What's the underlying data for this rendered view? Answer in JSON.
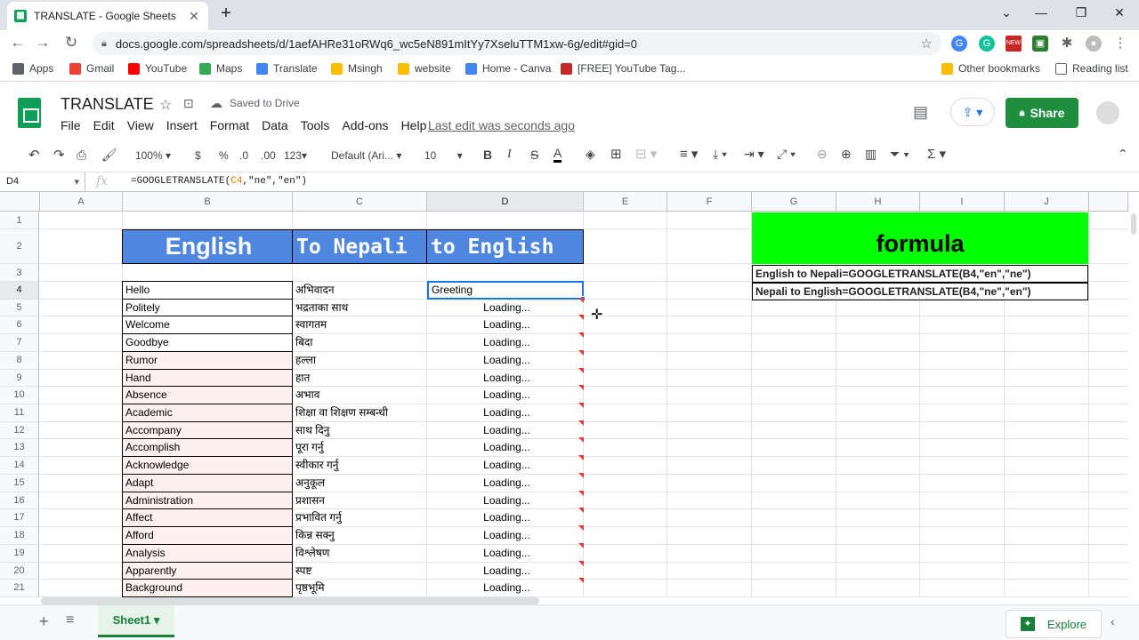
{
  "browser": {
    "tab_title": "TRANSLATE - Google Sheets",
    "url": "docs.google.com/spreadsheets/d/1aefAHRe31oRWq6_wc5eN891mItYy7XseluTTM1xw-6g/edit#gid=0",
    "bookmarks": [
      {
        "label": "Apps",
        "color": "#5f6368"
      },
      {
        "label": "Gmail",
        "color": "#ea4335"
      },
      {
        "label": "YouTube",
        "color": "#ff0000"
      },
      {
        "label": "Maps",
        "color": "#34a853"
      },
      {
        "label": "Translate",
        "color": "#4285f4"
      },
      {
        "label": "Msingh",
        "color": "#fbbc04"
      },
      {
        "label": "website",
        "color": "#fbbc04"
      },
      {
        "label": "Home - Canva",
        "color": "#4285f4"
      },
      {
        "label": "[FREE] YouTube Tag...",
        "color": "#c62828"
      }
    ],
    "other_bookmarks": "Other bookmarks",
    "reading_list": "Reading list",
    "ext_new": "NEW"
  },
  "app": {
    "title": "TRANSLATE",
    "saved": "Saved to Drive",
    "menus": [
      "File",
      "Edit",
      "View",
      "Insert",
      "Format",
      "Data",
      "Tools",
      "Add-ons",
      "Help"
    ],
    "last_edit": "Last edit was seconds ago",
    "share": "Share"
  },
  "toolbar": {
    "zoom": "100%",
    "currency": "$",
    "percent": "%",
    "dec_less": ".0",
    "dec_more": ".00",
    "format": "123",
    "font": "Default (Ari...",
    "size": "10"
  },
  "formula_bar": {
    "name_box": "D4",
    "fx": "fx",
    "formula_pre": "=GOOGLETRANSLATE(",
    "formula_ref": "C4",
    "formula_post": ",\"ne\",\"en\")"
  },
  "columns": [
    "A",
    "B",
    "C",
    "D",
    "E",
    "F",
    "G",
    "H",
    "I",
    "J"
  ],
  "rows": [
    "1",
    "2",
    "3",
    "4",
    "5",
    "6",
    "7",
    "8",
    "9",
    "10",
    "11",
    "12",
    "13",
    "14",
    "15",
    "16",
    "17",
    "18",
    "19",
    "20",
    "21"
  ],
  "headers": {
    "english": "English",
    "to_nepali": "To Nepali",
    "to_english": "to English"
  },
  "table": [
    {
      "en": "Hello",
      "ne": "अभिवादन",
      "out": "Greeting"
    },
    {
      "en": "Politely",
      "ne": "भद्रताका साथ",
      "out": "Loading..."
    },
    {
      "en": "Welcome",
      "ne": "स्वागतम",
      "out": "Loading..."
    },
    {
      "en": "Goodbye",
      "ne": "बिदा",
      "out": "Loading..."
    },
    {
      "en": "Rumor",
      "ne": "हल्ला",
      "out": "Loading..."
    },
    {
      "en": "Hand",
      "ne": "हात",
      "out": "Loading..."
    },
    {
      "en": "Absence",
      "ne": "अभाव",
      "out": "Loading..."
    },
    {
      "en": "Academic",
      "ne": "शिक्षा वा शिक्षण सम्बन्धी",
      "out": "Loading..."
    },
    {
      "en": "Accompany",
      "ne": "साथ दिनु",
      "out": "Loading..."
    },
    {
      "en": "Accomplish",
      "ne": "पूरा गर्नु",
      "out": "Loading..."
    },
    {
      "en": "Acknowledge",
      "ne": "स्वीकार गर्नु",
      "out": "Loading..."
    },
    {
      "en": "Adapt",
      "ne": "अनुकूल",
      "out": "Loading..."
    },
    {
      "en": "Administration",
      "ne": "प्रशासन",
      "out": "Loading..."
    },
    {
      "en": "Affect",
      "ne": "प्रभावित गर्नु",
      "out": "Loading..."
    },
    {
      "en": "Afford",
      "ne": "किन्न सक्नु",
      "out": "Loading..."
    },
    {
      "en": "Analysis",
      "ne": "विश्लेषण",
      "out": "Loading..."
    },
    {
      "en": "Apparently",
      "ne": "स्पष्ट",
      "out": "Loading..."
    },
    {
      "en": "Background",
      "ne": "पृष्ठभूमि",
      "out": "Loading..."
    }
  ],
  "formula_box": {
    "title": "formula",
    "line1": "English to Nepali=GOOGLETRANSLATE(B4,\"en\",\"ne\")",
    "line2": "Nepali to English=GOOGLETRANSLATE(B4,\"ne\",\"en\")"
  },
  "bottom": {
    "sheet": "Sheet1",
    "explore": "Explore"
  }
}
